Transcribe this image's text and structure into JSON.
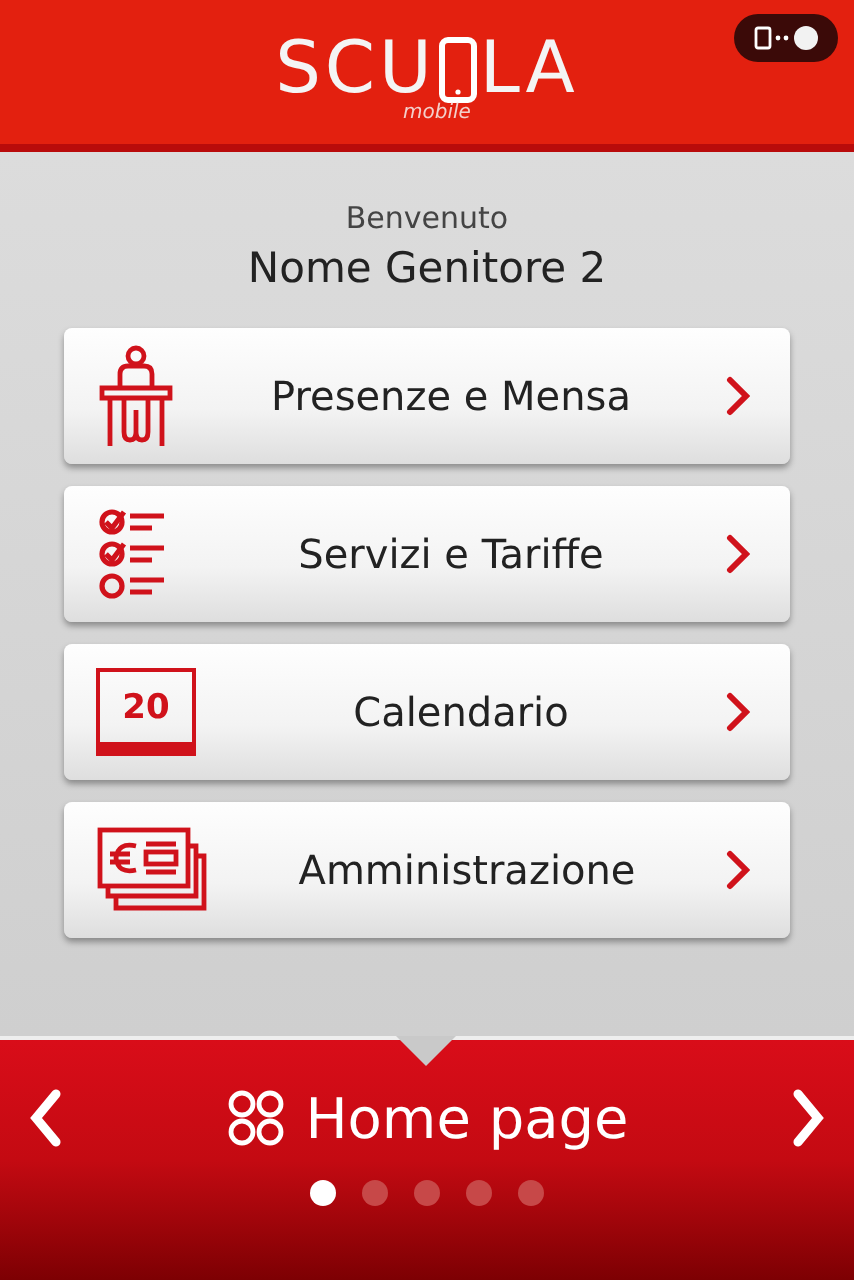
{
  "header": {
    "logo_before": "SCU",
    "logo_after": "LA",
    "tagline": "mobile",
    "toggle": {
      "on": true
    }
  },
  "welcome": {
    "greeting": "Benvenuto",
    "name": "Nome Genitore 2"
  },
  "menu": [
    {
      "kind": "attendance",
      "label": "Presenze e Mensa"
    },
    {
      "kind": "services",
      "label": "Servizi e Tariffe"
    },
    {
      "kind": "calendar",
      "label": "Calendario",
      "day": "20"
    },
    {
      "kind": "admin",
      "label": "Amministrazione"
    }
  ],
  "footer": {
    "title": "Home page",
    "pages": [
      {
        "selected": true
      },
      {
        "selected": false
      },
      {
        "selected": false
      },
      {
        "selected": false
      },
      {
        "selected": false
      }
    ]
  }
}
